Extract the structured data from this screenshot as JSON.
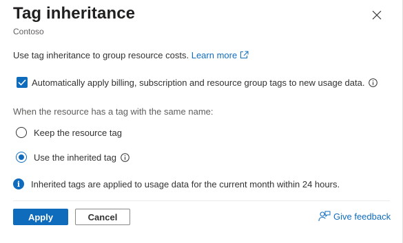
{
  "header": {
    "title": "Tag inheritance",
    "subtitle": "Contoso",
    "close_icon": "close-icon"
  },
  "intro": {
    "text": "Use tag inheritance to group resource costs.",
    "link_text": "Learn more",
    "link_icon": "external-link-icon"
  },
  "auto_apply": {
    "checked": true,
    "label": "Automatically apply billing, subscription and resource group tags to new usage data.",
    "info_icon": "info-icon"
  },
  "conflict": {
    "label": "When the resource has a tag with the same name:",
    "options": [
      {
        "label": "Keep the resource tag",
        "selected": false
      },
      {
        "label": "Use the inherited tag",
        "selected": true
      }
    ],
    "option_info_icon": "info-icon"
  },
  "notice": {
    "icon": "info-filled-icon",
    "text": "Inherited tags are applied to usage data for the current month within 24 hours."
  },
  "footer": {
    "apply_label": "Apply",
    "cancel_label": "Cancel",
    "feedback_label": "Give feedback",
    "feedback_icon": "feedback-person-icon"
  },
  "colors": {
    "accent": "#0f6cbd",
    "text": "#323130",
    "muted": "#605e5c"
  }
}
